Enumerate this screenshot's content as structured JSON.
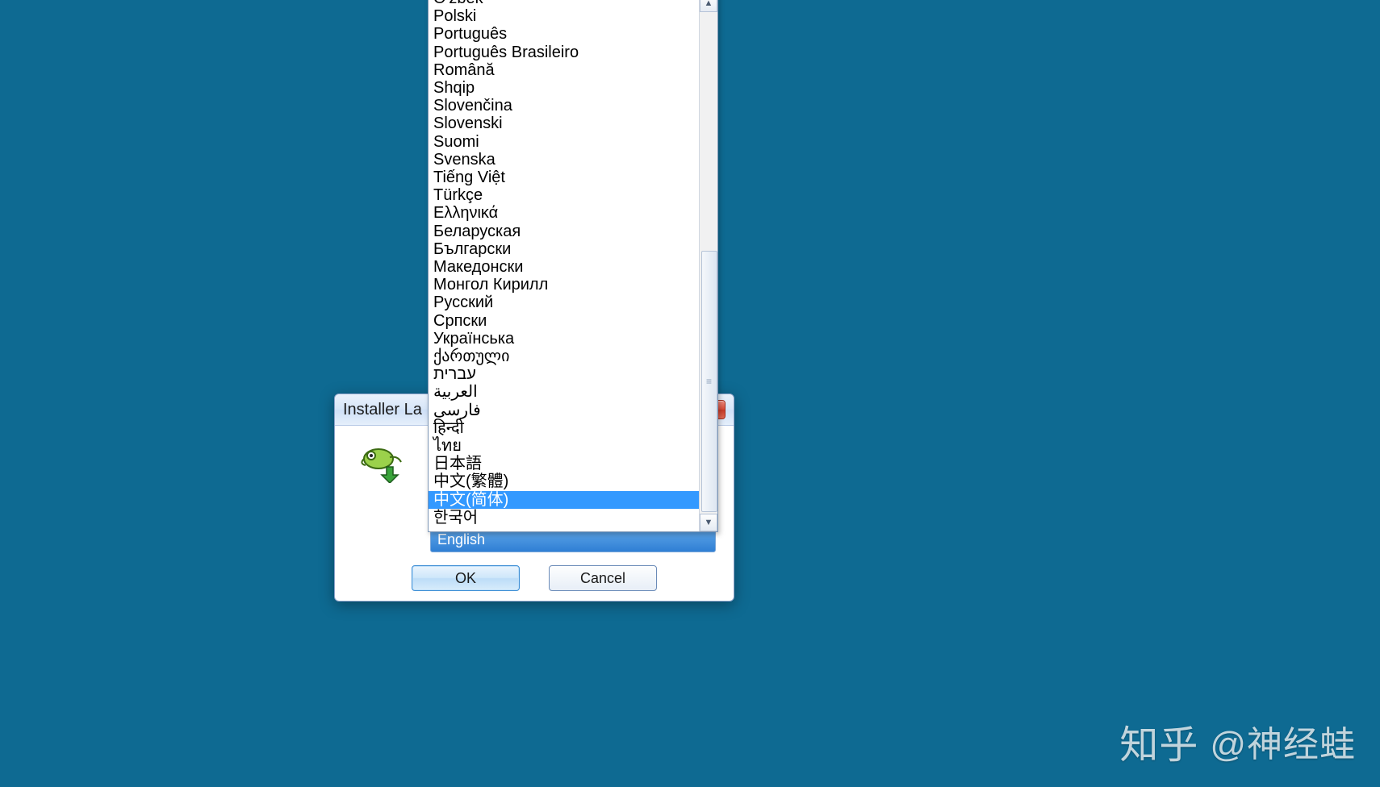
{
  "dialog": {
    "title": "Installer La",
    "combobox_value": "English",
    "ok_label": "OK",
    "cancel_label": "Cancel"
  },
  "dropdown": {
    "selected_index": 28,
    "items": [
      "O'zbek",
      "Polski",
      "Português",
      "Português Brasileiro",
      "Română",
      "Shqip",
      "Slovenčina",
      "Slovenski",
      "Suomi",
      "Svenska",
      "Tiếng Việt",
      "Türkçe",
      "Ελληνικά",
      "Беларуская",
      "Български",
      "Македонски",
      "Монгол Кирилл",
      "Русский",
      "Српски",
      "Українська",
      "ქართული",
      "עברית",
      "العربية",
      "فارسی",
      "हिन्दी",
      "ไทย",
      "日本語",
      "中文(繁體)",
      "中文(简体)",
      "한국어"
    ]
  },
  "watermark": {
    "logo": "知乎",
    "handle": "@神经蛙"
  }
}
